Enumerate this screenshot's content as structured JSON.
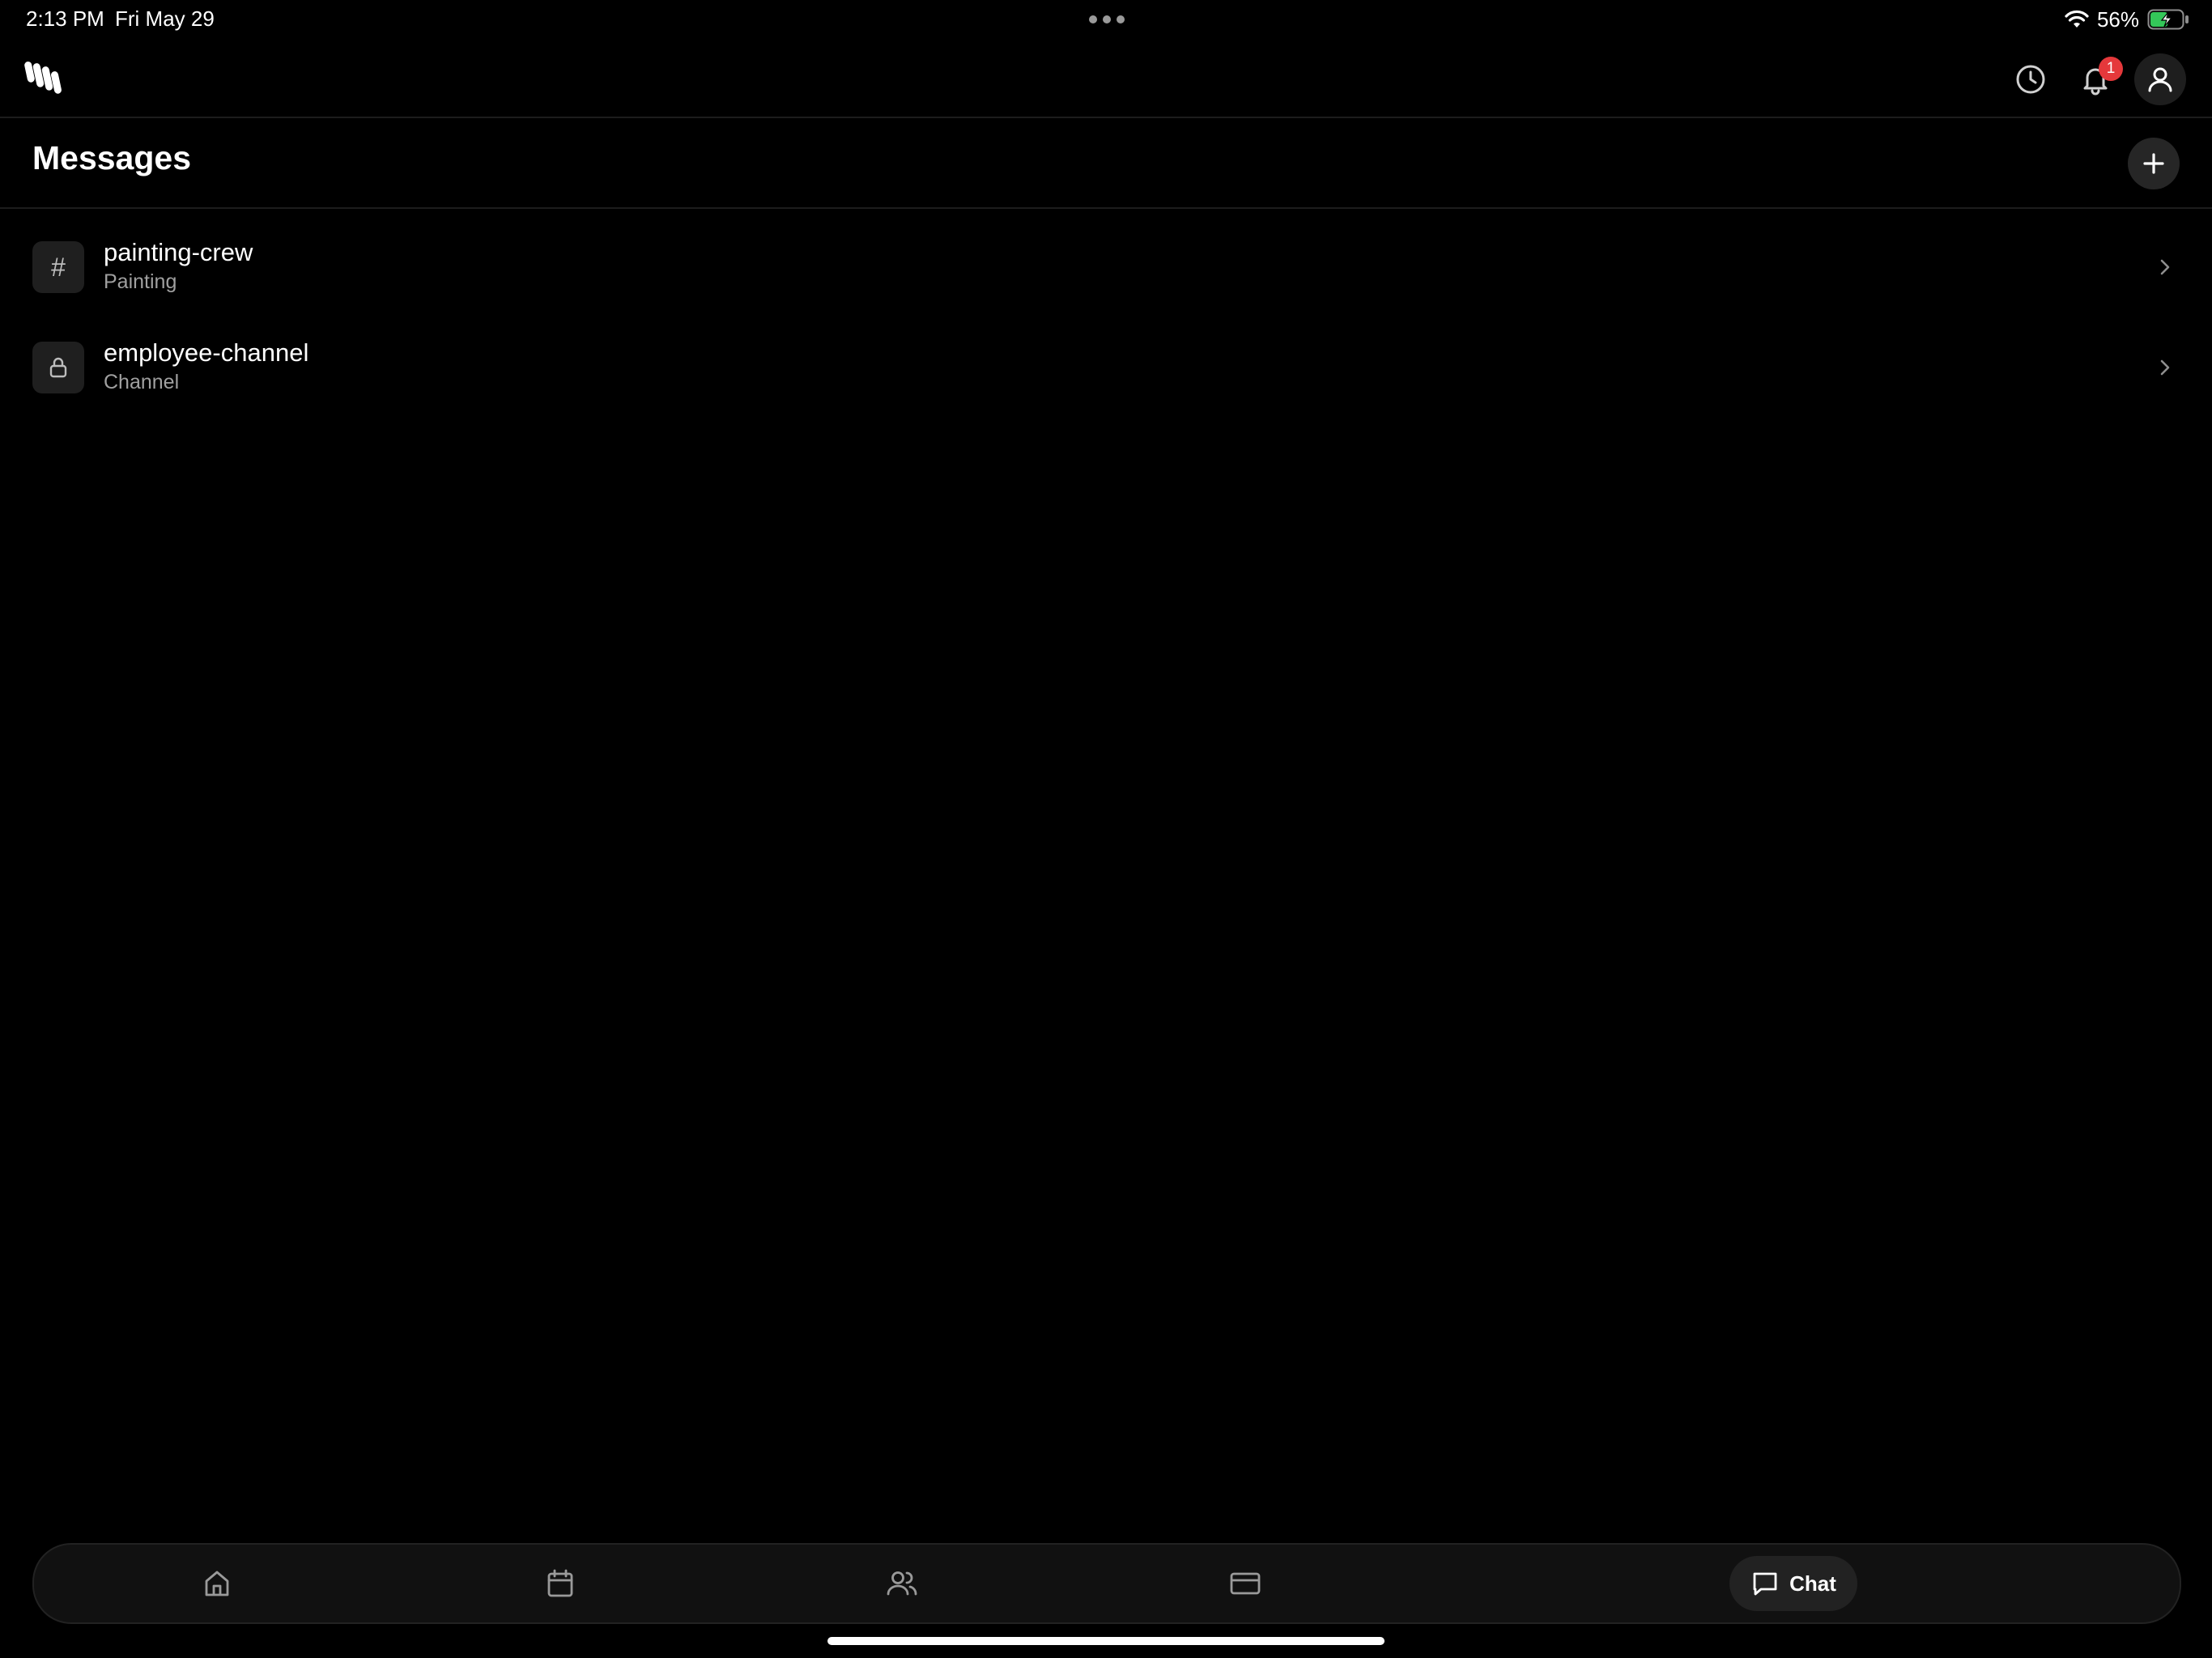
{
  "status_bar": {
    "time": "2:13 PM",
    "date": "Fri May 29",
    "battery_percent": "56%",
    "battery_level": 0.56,
    "charging": true
  },
  "header": {
    "logo_icon": "app-logo-icon",
    "history_icon": "clock-icon",
    "bell_icon": "bell-icon",
    "notification_count": "1",
    "profile_icon": "user-icon"
  },
  "messages": {
    "title": "Messages",
    "add_icon": "plus-icon"
  },
  "channels": [
    {
      "name": "painting-crew",
      "subtitle": "Painting",
      "icon": "hash-icon",
      "icon_glyph": "#"
    },
    {
      "name": "employee-channel",
      "subtitle": "Channel",
      "icon": "lock-icon",
      "icon_glyph": ""
    }
  ],
  "bottom_nav": {
    "items": [
      {
        "id": "home",
        "icon": "home-icon"
      },
      {
        "id": "calendar",
        "icon": "calendar-icon"
      },
      {
        "id": "people",
        "icon": "people-icon"
      },
      {
        "id": "billing",
        "icon": "card-icon"
      },
      {
        "id": "chat",
        "icon": "chat-icon",
        "label": "Chat",
        "active": true
      }
    ]
  },
  "colors": {
    "background": "#000000",
    "surface": "#111111",
    "badge": "#e5383b",
    "battery_fill": "#34c759",
    "muted_text": "#a0a0a0"
  }
}
